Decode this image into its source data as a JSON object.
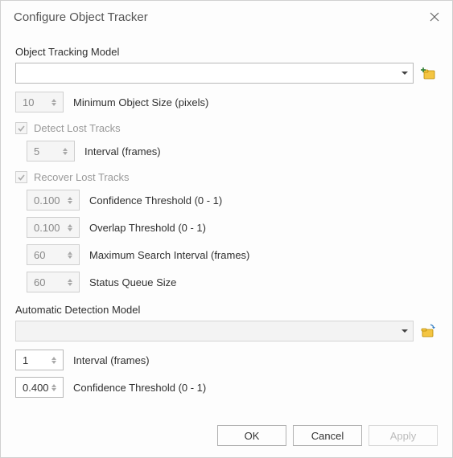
{
  "title": "Configure Object Tracker",
  "tracking_model": {
    "label": "Object Tracking Model",
    "value": ""
  },
  "min_object_size": {
    "label": "Minimum Object Size (pixels)",
    "value": "10"
  },
  "detect_lost": {
    "label": "Detect Lost Tracks",
    "checked": true,
    "interval": {
      "label": "Interval (frames)",
      "value": "5"
    }
  },
  "recover_lost": {
    "label": "Recover Lost Tracks",
    "checked": true,
    "confidence": {
      "label": "Confidence Threshold (0 - 1)",
      "value": "0.100"
    },
    "overlap": {
      "label": "Overlap Threshold (0 - 1)",
      "value": "0.100"
    },
    "max_search": {
      "label": "Maximum Search Interval (frames)",
      "value": "60"
    },
    "queue_size": {
      "label": "Status Queue Size",
      "value": "60"
    }
  },
  "detection_model": {
    "label": "Automatic Detection Model",
    "value": "",
    "interval": {
      "label": "Interval (frames)",
      "value": "1"
    },
    "confidence": {
      "label": "Confidence Threshold (0 - 1)",
      "value": "0.400"
    }
  },
  "buttons": {
    "ok": "OK",
    "cancel": "Cancel",
    "apply": "Apply"
  }
}
